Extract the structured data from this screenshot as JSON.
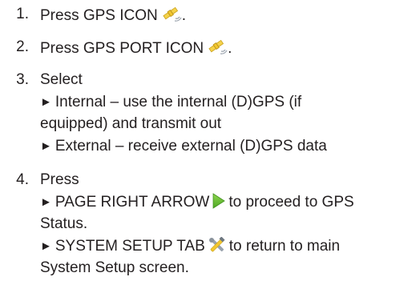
{
  "steps": [
    {
      "number": "1.",
      "text_before_icon": "Press GPS ICON",
      "icon": "gps-satellite-icon",
      "text_after_icon": "."
    },
    {
      "number": "2.",
      "text_before_icon": "Press GPS PORT ICON",
      "icon": "gps-satellite-icon",
      "text_after_icon": "."
    },
    {
      "number": "3.",
      "text": "Select",
      "options": [
        {
          "bullet": "►",
          "line1": "Internal – use the internal (D)GPS (if",
          "line2": "equipped) and transmit out"
        },
        {
          "bullet": "►",
          "line1": "External – receive external (D)GPS data"
        }
      ]
    },
    {
      "number": "4.",
      "text": "Press",
      "options": [
        {
          "bullet": "►",
          "line1_before_icon": "PAGE RIGHT ARROW",
          "icon": "green-right-arrow-icon",
          "line1_after_icon": "to proceed to GPS",
          "line2": "Status."
        },
        {
          "bullet": "►",
          "line1_before_icon": "SYSTEM SETUP TAB",
          "icon": "tools-icon",
          "line1_after_icon": "to return to main",
          "line2": "System Setup screen."
        }
      ]
    }
  ],
  "colors": {
    "text": "#231f20",
    "satellite_body": "#f2c72e",
    "satellite_panel": "#f5d24a",
    "signal": "#9aa3ad",
    "arrow_green": "#6fc23a"
  }
}
